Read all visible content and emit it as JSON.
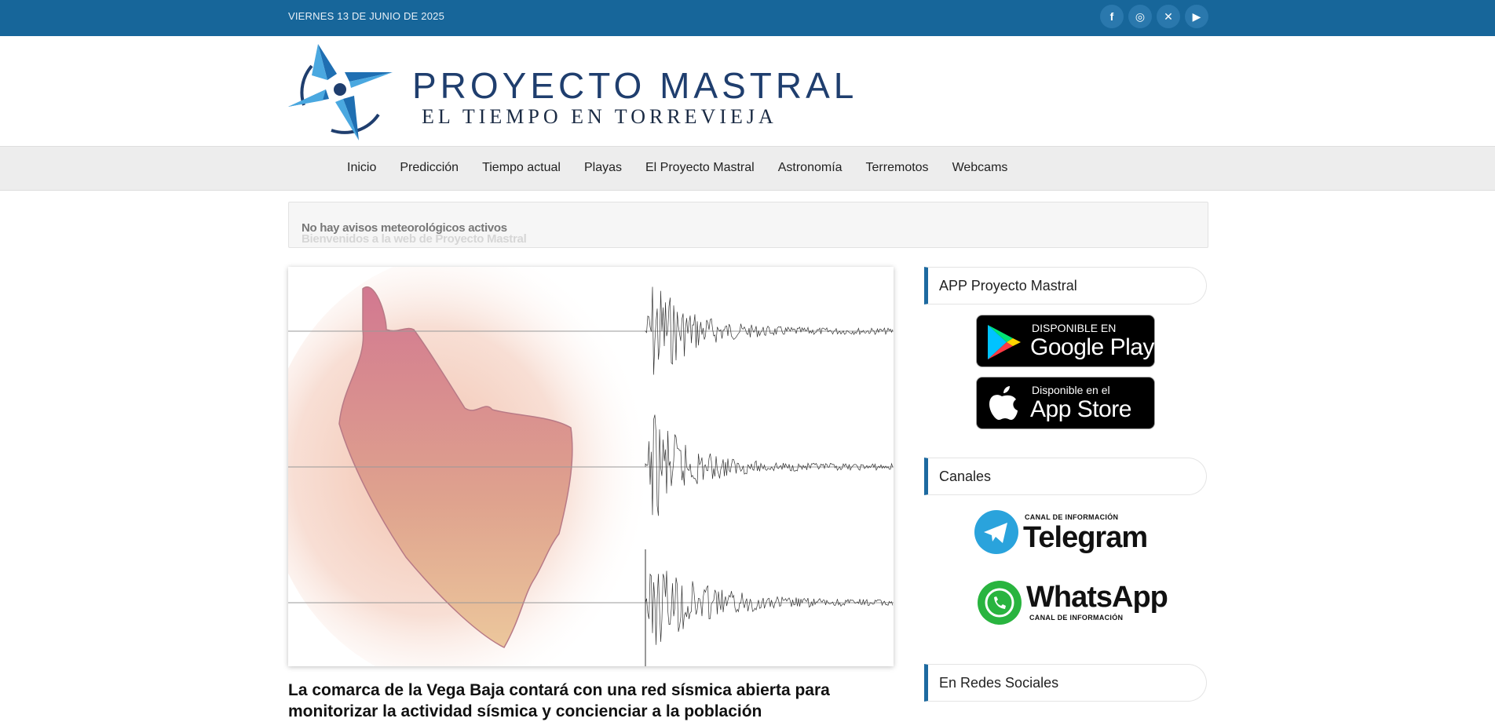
{
  "topbar": {
    "date": "VIERNES 13 DE JUNIO DE 2025",
    "socials": [
      {
        "icon": "facebook-icon",
        "glyph": "f"
      },
      {
        "icon": "instagram-icon",
        "glyph": "◎"
      },
      {
        "icon": "x-icon",
        "glyph": "✕"
      },
      {
        "icon": "youtube-icon",
        "glyph": "▶"
      }
    ]
  },
  "logo": {
    "title": "PROYECTO MASTRAL",
    "subtitle": "EL TIEMPO EN TORREVIEJA"
  },
  "nav": [
    "Inicio",
    "Predicción",
    "Tiempo actual",
    "Playas",
    "El Proyecto Mastral",
    "Astronomía",
    "Terremotos",
    "Webcams"
  ],
  "alerts": {
    "line1": "No hay avisos meteorológicos activos",
    "line2": "Bienvenidos a la web de Proyecto Mastral"
  },
  "article": {
    "headline": "La comarca de la Vega Baja contará con una red sísmica abierta para monitorizar la actividad sísmica y concienciar a la población"
  },
  "sidebar": {
    "app_title": "APP Proyecto Mastral",
    "google_play": {
      "small": "DISPONIBLE EN",
      "big": "Google Play"
    },
    "app_store": {
      "small": "Disponible en el",
      "big": "App Store"
    },
    "channels_title": "Canales",
    "telegram": {
      "small": "CANAL DE INFORMACIÓN",
      "big": "Telegram"
    },
    "whatsapp": {
      "small": "CANAL DE INFORMACIÓN",
      "big": "WhatsApp"
    },
    "social_title": "En Redes Sociales"
  },
  "colors": {
    "topbar": "#17669a",
    "accent": "#1d6aa0",
    "telegram": "#2aa3dc",
    "whatsapp": "#29b43f"
  }
}
